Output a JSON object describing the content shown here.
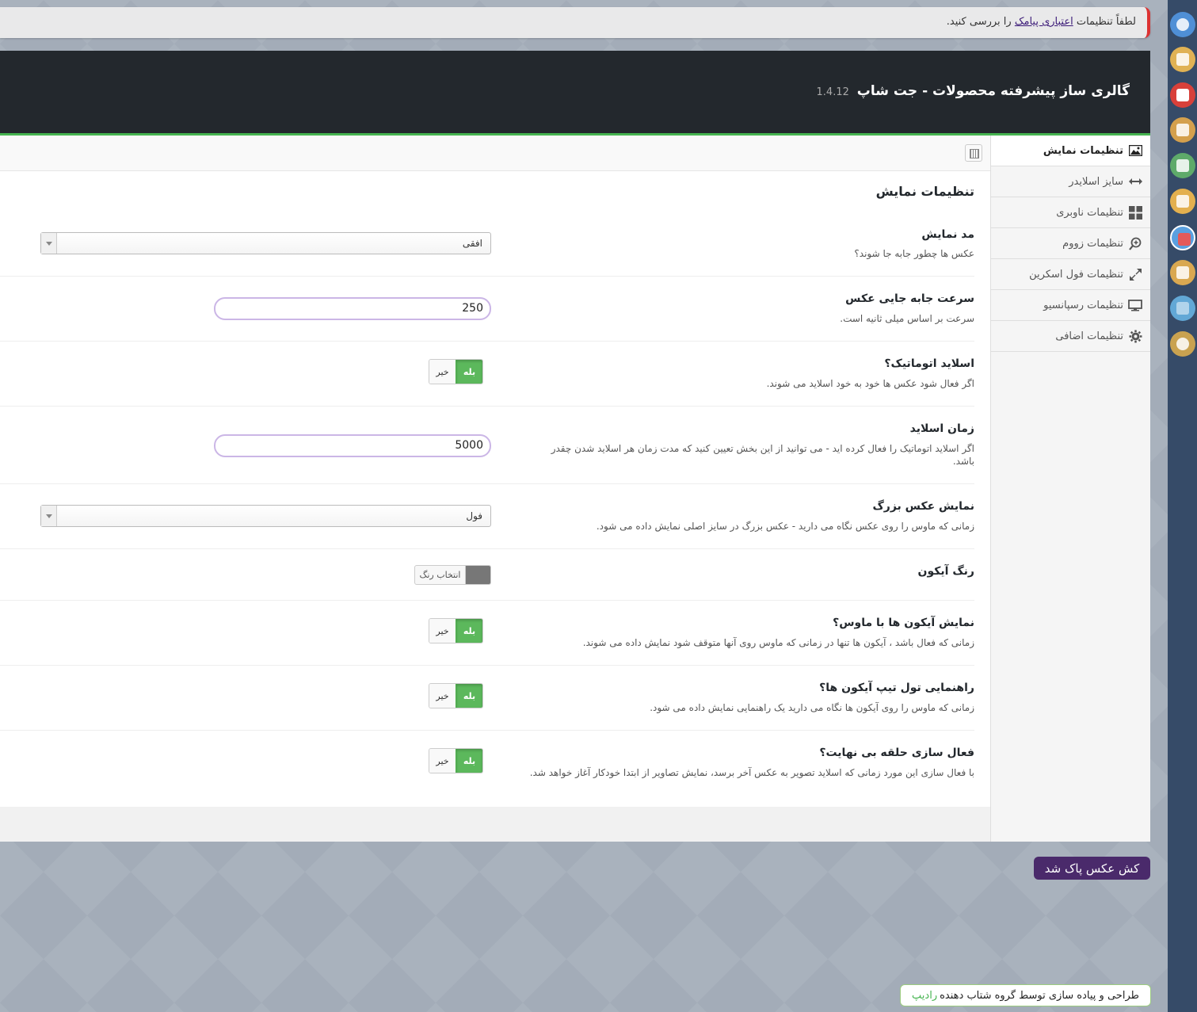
{
  "notice": {
    "prefix": "لطفاً تنظیمات",
    "link": "اعتباری پیامک",
    "suffix": "را بررسی کنید."
  },
  "header": {
    "title": "گالری ساز پیشرفته محصولات - جت شاپ",
    "version": "1.4.12"
  },
  "sidebar": {
    "items": [
      {
        "label": "تنظیمات نمایش",
        "icon": "image-icon"
      },
      {
        "label": "سایز اسلایدر",
        "icon": "arrows-horizontal-icon"
      },
      {
        "label": "تنظیمات ناوبری",
        "icon": "grid-icon"
      },
      {
        "label": "تنظیمات زووم",
        "icon": "zoom-icon"
      },
      {
        "label": "تنظیمات فول اسکرین",
        "icon": "fullscreen-icon"
      },
      {
        "label": "تنظیمات رسپانسیو",
        "icon": "monitor-icon"
      },
      {
        "label": "تنظیمات اضافی",
        "icon": "gear-icon"
      }
    ]
  },
  "section": {
    "title": "تنظیمات نمایش"
  },
  "fields": {
    "display_mode": {
      "label": "مد نمایش",
      "desc": "عکس ها چطور جابه جا شوند؟",
      "value": "افقی"
    },
    "slide_speed": {
      "label": "سرعت جابه جایی عکس",
      "desc": "سرعت بر اساس میلی ثانیه است.",
      "value": "250"
    },
    "autoplay": {
      "label": "اسلاید اتوماتیک؟",
      "desc": "اگر فعال شود عکس ها خود به خود اسلاید می شوند.",
      "yes": "بله",
      "no": "خیر"
    },
    "slide_time": {
      "label": "زمان اسلاید",
      "desc": "اگر اسلاید اتوماتیک را فعال کرده اید - می توانید از این بخش تعیین کنید که مدت زمان هر اسلاید شدن چقدر باشد.",
      "value": "5000"
    },
    "large_image": {
      "label": "نمایش عکس بزرگ",
      "desc": "زمانی که ماوس را روی عکس نگاه می دارید - عکس بزرگ در سایز اصلی نمایش داده می شود.",
      "value": "فول"
    },
    "icon_color": {
      "label": "رنگ آیکون",
      "button": "انتخاب رنگ",
      "color": "#777777"
    },
    "icons_hover": {
      "label": "نمایش آیکون ها با ماوس؟",
      "desc": "زمانی که فعال باشد ، آیکون ها تنها در زمانی که ماوس روی آنها متوقف شود نمایش داده می شوند.",
      "yes": "بله",
      "no": "خیر"
    },
    "tooltip": {
      "label": "راهنمایی تول تیپ آیکون ها؟",
      "desc": "زمانی که ماوس را روی آیکون ها نگاه می دارید یک راهنمایی نمایش داده می شود.",
      "yes": "بله",
      "no": "خیر"
    },
    "infinite_loop": {
      "label": "فعال سازی حلقه بی نهایت؟",
      "desc": "با فعال سازی این مورد زمانی که اسلاید تصویر به عکس آخر برسد، نمایش تصاویر از ابتدا خودکار آغاز خواهد شد.",
      "yes": "بله",
      "no": "خیر"
    }
  },
  "cache_notice": "کش عکس پاک شد",
  "footer": {
    "text": "طراحی و پیاده سازی توسط گروه شتاب دهنده",
    "brand": "رادیپ"
  },
  "adminbar": {
    "icons": [
      {
        "name": "dashboard-icon",
        "color": "#4f8fd6"
      },
      {
        "name": "notes-icon",
        "color": "#e0b254"
      },
      {
        "name": "youtube-icon",
        "color": "#d8403a"
      },
      {
        "name": "document-icon",
        "color": "#d4a04d"
      },
      {
        "name": "page-icon",
        "color": "#5eaa6a"
      },
      {
        "name": "tools-icon",
        "color": "#e3b04f"
      },
      {
        "name": "shop-icon",
        "color": "#5aa0e0"
      },
      {
        "name": "counter-icon",
        "color": "#d9a851"
      },
      {
        "name": "sms-icon",
        "color": "#62a8d6"
      },
      {
        "name": "settings-gear-icon",
        "color": "#c9a250"
      }
    ]
  }
}
